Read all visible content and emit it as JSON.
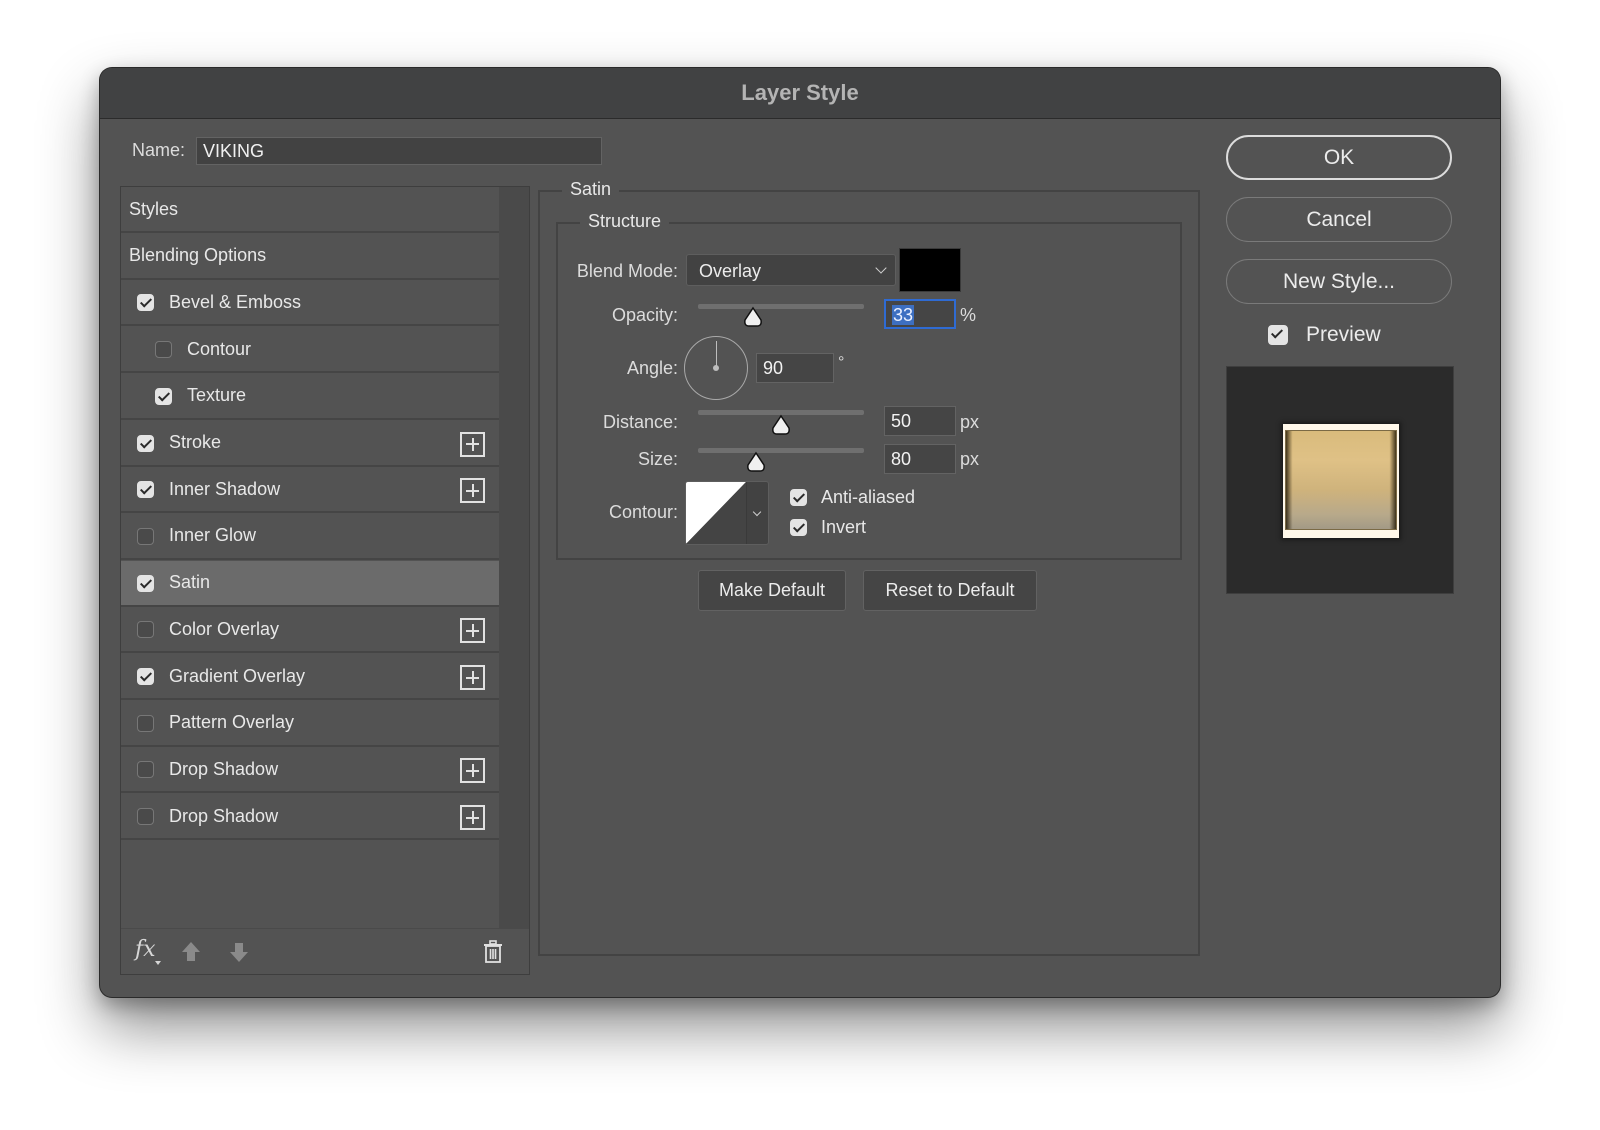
{
  "window": {
    "title": "Layer Style"
  },
  "name_field": {
    "label": "Name:",
    "value": "VIKING"
  },
  "styles_list": {
    "items": [
      {
        "label": "Styles",
        "has_checkbox": false,
        "checked": false,
        "indent": false,
        "has_plus": false,
        "selected": false
      },
      {
        "label": "Blending Options",
        "has_checkbox": false,
        "checked": false,
        "indent": false,
        "has_plus": false,
        "selected": false
      },
      {
        "label": "Bevel & Emboss",
        "has_checkbox": true,
        "checked": true,
        "indent": false,
        "has_plus": false,
        "selected": false
      },
      {
        "label": "Contour",
        "has_checkbox": true,
        "checked": false,
        "indent": true,
        "has_plus": false,
        "selected": false
      },
      {
        "label": "Texture",
        "has_checkbox": true,
        "checked": true,
        "indent": true,
        "has_plus": false,
        "selected": false
      },
      {
        "label": "Stroke",
        "has_checkbox": true,
        "checked": true,
        "indent": false,
        "has_plus": true,
        "selected": false
      },
      {
        "label": "Inner Shadow",
        "has_checkbox": true,
        "checked": true,
        "indent": false,
        "has_plus": true,
        "selected": false
      },
      {
        "label": "Inner Glow",
        "has_checkbox": true,
        "checked": false,
        "indent": false,
        "has_plus": false,
        "selected": false
      },
      {
        "label": "Satin",
        "has_checkbox": true,
        "checked": true,
        "indent": false,
        "has_plus": false,
        "selected": true
      },
      {
        "label": "Color Overlay",
        "has_checkbox": true,
        "checked": false,
        "indent": false,
        "has_plus": true,
        "selected": false
      },
      {
        "label": "Gradient Overlay",
        "has_checkbox": true,
        "checked": true,
        "indent": false,
        "has_plus": true,
        "selected": false
      },
      {
        "label": "Pattern Overlay",
        "has_checkbox": true,
        "checked": false,
        "indent": false,
        "has_plus": false,
        "selected": false
      },
      {
        "label": "Drop Shadow",
        "has_checkbox": true,
        "checked": false,
        "indent": false,
        "has_plus": true,
        "selected": false
      },
      {
        "label": "Drop Shadow",
        "has_checkbox": true,
        "checked": false,
        "indent": false,
        "has_plus": true,
        "selected": false
      }
    ],
    "footer": {
      "fx_label": "fx"
    }
  },
  "satin": {
    "group_title": "Satin",
    "structure_title": "Structure",
    "blend_mode": {
      "label": "Blend Mode:",
      "value": "Overlay",
      "color": "#000000"
    },
    "opacity": {
      "label": "Opacity:",
      "value": "33",
      "unit": "%",
      "slider_fraction": 0.33
    },
    "angle": {
      "label": "Angle:",
      "value": "90",
      "unit": "°"
    },
    "distance": {
      "label": "Distance:",
      "value": "50",
      "unit": "px",
      "slider_fraction": 0.5
    },
    "size": {
      "label": "Size:",
      "value": "80",
      "unit": "px",
      "slider_fraction": 0.35
    },
    "contour": {
      "label": "Contour:"
    },
    "anti_aliased": {
      "label": "Anti-aliased",
      "checked": true
    },
    "invert": {
      "label": "Invert",
      "checked": true
    },
    "make_default_label": "Make Default",
    "reset_default_label": "Reset to Default"
  },
  "actions": {
    "ok_label": "OK",
    "cancel_label": "Cancel",
    "new_style_label": "New Style...",
    "preview": {
      "label": "Preview",
      "checked": true
    }
  }
}
